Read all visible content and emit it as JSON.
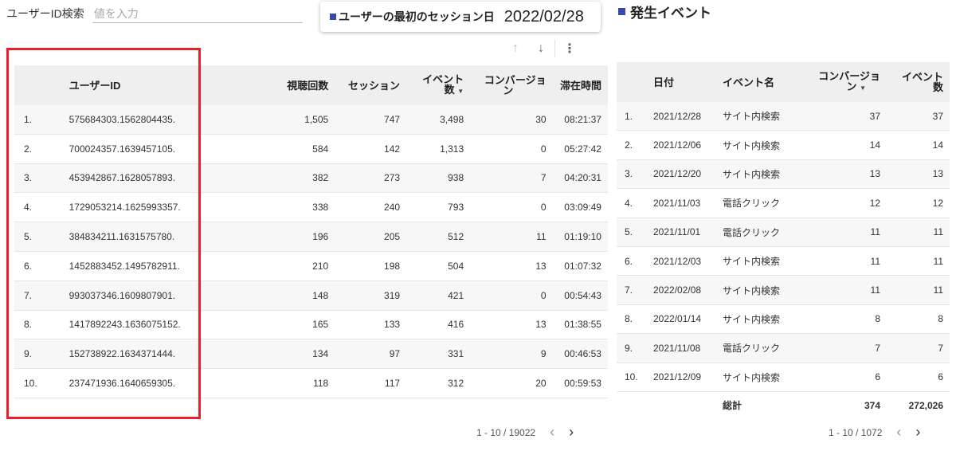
{
  "search": {
    "label": "ユーザーID検索",
    "placeholder": "値を入力"
  },
  "tooltip": {
    "dimension": "ユーザーの最初のセッション日",
    "value": "2022/02/28",
    "color": "#3949ab"
  },
  "left_table": {
    "toolbar": {
      "up_icon": "↑",
      "down_icon": "↓",
      "more_icon": "⋮"
    },
    "headers": {
      "user_id": "ユーザーID",
      "views": "視聴回数",
      "sessions": "セッション",
      "events_l1": "イベント",
      "events_l2": "数",
      "conversions_l1": "コンバージョ",
      "conversions_l2": "ン",
      "duration": "滞在時間",
      "sort_arrow": "▼"
    },
    "rows": [
      {
        "index": "1.",
        "user_id": "575684303.1562804435.",
        "views": "1,505",
        "sessions": "747",
        "events": "3,498",
        "conversions": "30",
        "duration": "08:21:37"
      },
      {
        "index": "2.",
        "user_id": "700024357.1639457105.",
        "views": "584",
        "sessions": "142",
        "events": "1,313",
        "conversions": "0",
        "duration": "05:27:42"
      },
      {
        "index": "3.",
        "user_id": "453942867.1628057893.",
        "views": "382",
        "sessions": "273",
        "events": "938",
        "conversions": "7",
        "duration": "04:20:31"
      },
      {
        "index": "4.",
        "user_id": "1729053214.1625993357.",
        "views": "338",
        "sessions": "240",
        "events": "793",
        "conversions": "0",
        "duration": "03:09:49"
      },
      {
        "index": "5.",
        "user_id": "384834211.1631575780.",
        "views": "196",
        "sessions": "205",
        "events": "512",
        "conversions": "11",
        "duration": "01:19:10"
      },
      {
        "index": "6.",
        "user_id": "1452883452.1495782911.",
        "views": "210",
        "sessions": "198",
        "events": "504",
        "conversions": "13",
        "duration": "01:07:32"
      },
      {
        "index": "7.",
        "user_id": "993037346.1609807901.",
        "views": "148",
        "sessions": "319",
        "events": "421",
        "conversions": "0",
        "duration": "00:54:43"
      },
      {
        "index": "8.",
        "user_id": "1417892243.1636075152.",
        "views": "165",
        "sessions": "133",
        "events": "416",
        "conversions": "13",
        "duration": "01:38:55"
      },
      {
        "index": "9.",
        "user_id": "152738922.1634371444.",
        "views": "134",
        "sessions": "97",
        "events": "331",
        "conversions": "9",
        "duration": "00:46:53"
      },
      {
        "index": "10.",
        "user_id": "237471936.1640659305.",
        "views": "118",
        "sessions": "117",
        "events": "312",
        "conversions": "20",
        "duration": "00:59:53"
      }
    ],
    "pagination": {
      "range": "1 - 10 / 19022",
      "prev": "‹",
      "next": "›"
    }
  },
  "right_panel": {
    "title": "発生イベント",
    "headers": {
      "date": "日付",
      "event_name": "イベント名",
      "conversions_l1": "コンバージョ",
      "conversions_l2": "ン",
      "events_l1": "イベント",
      "events_l2": "数",
      "sort_arrow": "▼"
    },
    "rows": [
      {
        "index": "1.",
        "date": "2021/12/28",
        "event_name": "サイト内検索",
        "conversions": "37",
        "events": "37"
      },
      {
        "index": "2.",
        "date": "2021/12/06",
        "event_name": "サイト内検索",
        "conversions": "14",
        "events": "14"
      },
      {
        "index": "3.",
        "date": "2021/12/20",
        "event_name": "サイト内検索",
        "conversions": "13",
        "events": "13"
      },
      {
        "index": "4.",
        "date": "2021/11/03",
        "event_name": "電話クリック",
        "conversions": "12",
        "events": "12"
      },
      {
        "index": "5.",
        "date": "2021/11/01",
        "event_name": "電話クリック",
        "conversions": "11",
        "events": "11"
      },
      {
        "index": "6.",
        "date": "2021/12/03",
        "event_name": "サイト内検索",
        "conversions": "11",
        "events": "11"
      },
      {
        "index": "7.",
        "date": "2022/02/08",
        "event_name": "サイト内検索",
        "conversions": "11",
        "events": "11"
      },
      {
        "index": "8.",
        "date": "2022/01/14",
        "event_name": "サイト内検索",
        "conversions": "8",
        "events": "8"
      },
      {
        "index": "9.",
        "date": "2021/11/08",
        "event_name": "電話クリック",
        "conversions": "7",
        "events": "7"
      },
      {
        "index": "10.",
        "date": "2021/12/09",
        "event_name": "サイト内検索",
        "conversions": "6",
        "events": "6"
      }
    ],
    "total": {
      "label": "総計",
      "conversions": "374",
      "events": "272,026"
    },
    "pagination": {
      "range": "1 - 10 / 1072",
      "prev": "‹",
      "next": "›"
    }
  },
  "colors": {
    "accent": "#3949ab",
    "highlight": "#e8202a"
  }
}
